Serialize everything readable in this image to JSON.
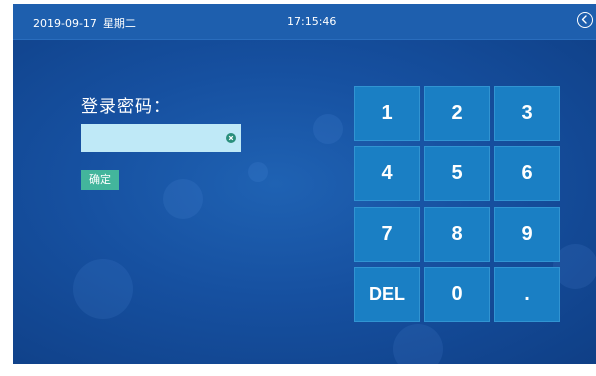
{
  "status_bar": {
    "date": "2019-09-17",
    "weekday": "星期二",
    "time": "17:15:46",
    "back_icon": "chevron-left-circle-icon"
  },
  "login": {
    "label": "登录密码：",
    "password_value": "",
    "clear_icon": "clear-circle-icon",
    "confirm_label": "确定"
  },
  "keypad": {
    "keys": [
      "1",
      "2",
      "3",
      "4",
      "5",
      "6",
      "7",
      "8",
      "9",
      "DEL",
      "0",
      "."
    ]
  },
  "colors": {
    "background": "#1650a0",
    "status_bar": "#1e5fae",
    "key": "#1a7fc4",
    "input": "#bfe9f7",
    "confirm_button": "#43b59c",
    "clear_icon": "#2a8f7c",
    "text": "#ffffff"
  }
}
